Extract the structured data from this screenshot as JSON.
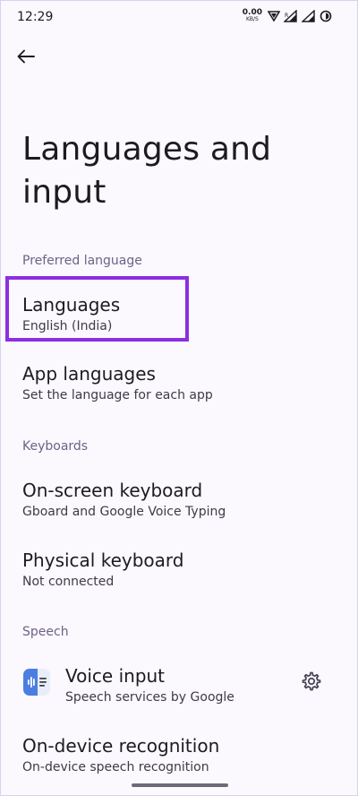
{
  "status_bar": {
    "time": "12:29",
    "net_speed_value": "0.00",
    "net_speed_unit": "KB/S",
    "icons": [
      "vpn-key-icon",
      "signal-icon",
      "signal-icon-2",
      "battery-icon"
    ]
  },
  "header": {
    "back_icon": "arrow-left-icon",
    "title": "Languages and input"
  },
  "sections": {
    "preferred_language": {
      "header": "Preferred language",
      "languages": {
        "title": "Languages",
        "summary": "English (India)"
      },
      "app_languages": {
        "title": "App languages",
        "summary": "Set the language for each app"
      }
    },
    "keyboards": {
      "header": "Keyboards",
      "on_screen_keyboard": {
        "title": "On-screen keyboard",
        "summary": "Gboard and Google Voice Typing"
      },
      "physical_keyboard": {
        "title": "Physical keyboard",
        "summary": "Not connected"
      }
    },
    "speech": {
      "header": "Speech",
      "voice_input": {
        "title": "Voice input",
        "summary": "Speech services by Google",
        "icon": "speech-services-icon",
        "settings_icon": "gear-icon"
      },
      "on_device_recognition": {
        "title": "On-device recognition",
        "summary": "On-device speech recognition"
      }
    }
  },
  "colors": {
    "background": "#FBF8FE",
    "highlight": "#8B2FE0",
    "section_header": "#6E6287",
    "voice_icon_blue": "#4A7FE0"
  }
}
